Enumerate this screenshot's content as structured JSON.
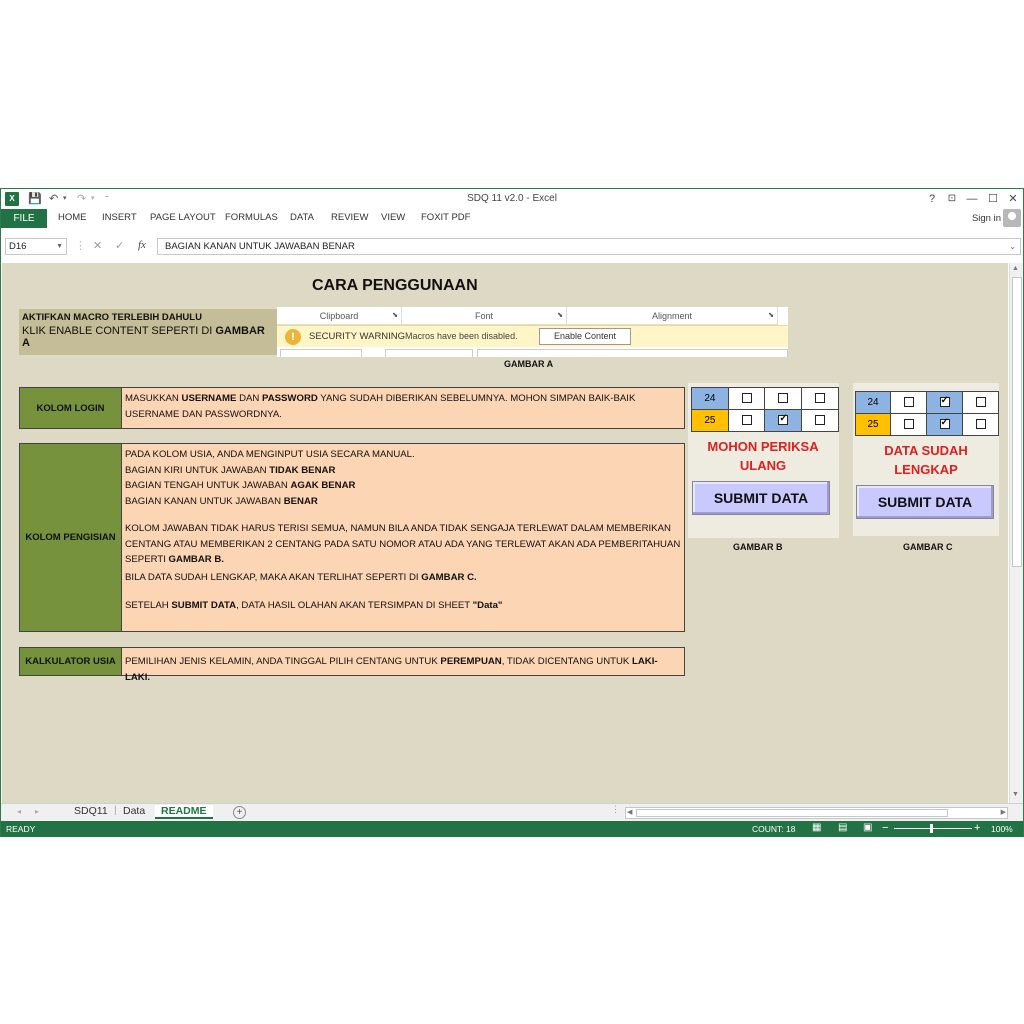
{
  "window": {
    "title": "SDQ 11 v2.0 - Excel",
    "help": "?",
    "min": "—",
    "max": "☐",
    "close": "✕",
    "ribbon_opts": "⊡"
  },
  "ribbon": {
    "file": "FILE",
    "tabs": [
      "HOME",
      "INSERT",
      "PAGE LAYOUT",
      "FORMULAS",
      "DATA",
      "REVIEW",
      "VIEW",
      "FOXIT PDF"
    ],
    "signin": "Sign in"
  },
  "formula_bar": {
    "name_box": "D16",
    "content": "BAGIAN KANAN UNTUK JAWABAN BENAR",
    "fx": "fx"
  },
  "sheet": {
    "title": "CARA PENGGUNAAN",
    "macro_line1": "AKTIFKAN MACRO TERLEBIH DAHULU",
    "macro_line2_pre": "KLIK ENABLE CONTENT SEPERTI DI ",
    "macro_line2_bold": "GAMBAR A",
    "gambar_a": {
      "groups": [
        "Clipboard",
        "Font",
        "Alignment"
      ],
      "security_bold": "SECURITY WARNING",
      "security_msg": "Macros have been disabled.",
      "enable_btn": "Enable Content",
      "caption": "GAMBAR A"
    },
    "login": {
      "label": "KOLOM LOGIN",
      "t1": "MASUKKAN ",
      "b1": "USERNAME",
      "t2": " DAN ",
      "b2": "PASSWORD",
      "t3": " YANG SUDAH DIBERIKAN SEBELUMNYA. MOHON SIMPAN BAIK-BAIK USERNAME DAN PASSWORDNYA."
    },
    "pengisian": {
      "label": "KOLOM PENGISIAN",
      "l1": "PADA KOLOM USIA, ANDA MENGINPUT USIA SECARA MANUAL.",
      "l2": "BAGIAN KIRI UNTUK JAWABAN ",
      "l2b": "TIDAK BENAR",
      "l3": "BAGIAN TENGAH UNTUK JAWABAN ",
      "l3b": "AGAK BENAR",
      "l4": "BAGIAN KANAN UNTUK JAWABAN ",
      "l4b": "BENAR",
      "p2": "KOLOM JAWABAN TIDAK HARUS TERISI SEMUA, NAMUN BILA ANDA TIDAK SENGAJA TERLEWAT DALAM MEMBERIKAN CENTANG ATAU MEMBERIKAN 2 CENTANG PADA SATU NOMOR ATAU ADA YANG TERLEWAT AKAN ADA PEMBERITAHUAN SEPERTI ",
      "p2b": "GAMBAR B.",
      "p3": "BILA DATA SUDAH LENGKAP, MAKA AKAN TERLIHAT SEPERTI DI ",
      "p3b": "GAMBAR C.",
      "p4": "SETELAH ",
      "p4b": "SUBMIT DATA",
      "p4c": ", DATA HASIL OLAHAN AKAN TERSIMPAN DI SHEET ",
      "p4d": "\"Data\""
    },
    "kalkulator": {
      "label": "KALKULATOR USIA",
      "t1": "PEMILIHAN JENIS KELAMIN, ANDA TINGGAL PILIH CENTANG UNTUK ",
      "b1": "PEREMPUAN",
      "t2": ", TIDAK DICENTANG UNTUK ",
      "b2": "LAKI-LAKI."
    },
    "gambar_b": {
      "rows": [
        "24",
        "25"
      ],
      "message": "MOHON PERIKSA ULANG",
      "submit": "SUBMIT DATA",
      "caption": "GAMBAR B"
    },
    "gambar_c": {
      "rows": [
        "24",
        "25"
      ],
      "message": "DATA SUDAH LENGKAP",
      "submit": "SUBMIT DATA",
      "caption": "GAMBAR C"
    }
  },
  "sheet_tabs": [
    "SDQ11",
    "Data",
    "README"
  ],
  "active_tab": "README",
  "status": {
    "ready": "READY",
    "count": "COUNT: 18",
    "zoom": "100%"
  },
  "colors": {
    "excel_green": "#217346",
    "sheet_bg": "#ddd9c4",
    "label_green": "#76923c",
    "body_peach": "#fcd5b4",
    "warn_red": "#e0201e"
  }
}
